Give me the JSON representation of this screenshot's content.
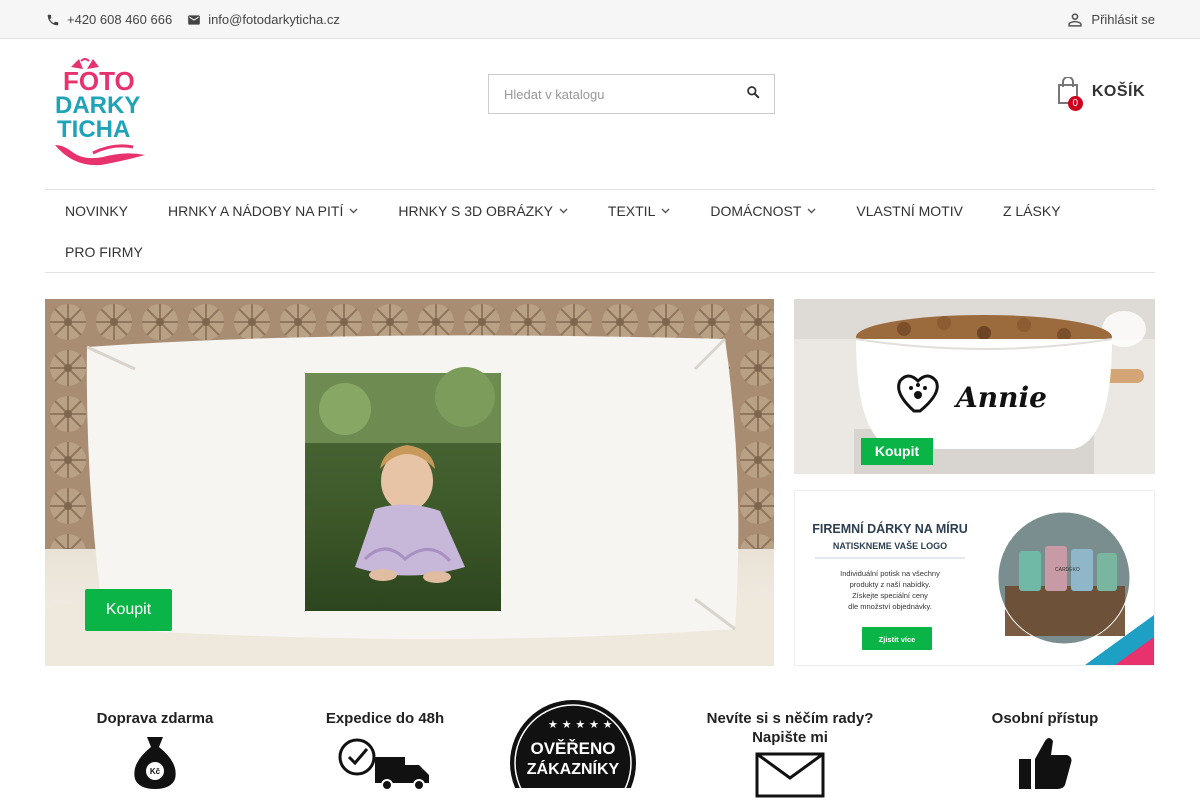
{
  "topbar": {
    "phone": "+420 608 460 666",
    "email": "info@fotodarkyticha.cz",
    "login": "Přihlásit se"
  },
  "logo": {
    "line1": "FOTO",
    "line2": "DARKY",
    "line3": "TICHA"
  },
  "search": {
    "placeholder": "Hledat v katalogu"
  },
  "cart": {
    "label": "KOŠÍK",
    "count": "0"
  },
  "nav": {
    "items": [
      {
        "label": "NOVINKY",
        "has_dropdown": false
      },
      {
        "label": "HRNKY A NÁDOBY NA PITÍ",
        "has_dropdown": true
      },
      {
        "label": "HRNKY S 3D OBRÁZKY",
        "has_dropdown": true
      },
      {
        "label": "TEXTIL",
        "has_dropdown": true
      },
      {
        "label": "DOMÁCNOST",
        "has_dropdown": true
      },
      {
        "label": "VLASTNÍ MOTIV",
        "has_dropdown": false
      },
      {
        "label": "Z LÁSKY",
        "has_dropdown": false
      },
      {
        "label": "PRO FIRMY",
        "has_dropdown": false
      }
    ]
  },
  "hero": {
    "button": "Koupit"
  },
  "side1": {
    "name": "Annie",
    "button": "Koupit"
  },
  "side2": {
    "title": "FIREMNÍ DÁRKY NA MÍRU",
    "subtitle": "NATISKNEME VAŠE LOGO",
    "text1": "Individuální potisk na všechny",
    "text2": "produkty z naší nabídky.",
    "text3": "Získejte speciální ceny",
    "text4": "dle množství objednávky.",
    "button": "Zjistit více",
    "cup_brand": "CARDEKO"
  },
  "features": {
    "shipping": "Doprava zdarma",
    "shipping_currency": "Kč",
    "dispatch": "Expedice do 48h",
    "verified1": "OVĚŘENO",
    "verified2": "ZÁKAZNÍKY",
    "advice1": "Nevíte si s něčím rady?",
    "advice2": "Napište mi",
    "personal": "Osobní přístup"
  },
  "colors": {
    "accent_green": "#0bb446",
    "badge_red": "#d0021b",
    "logo_pink": "#e8326e",
    "logo_teal": "#1fa3b8"
  }
}
